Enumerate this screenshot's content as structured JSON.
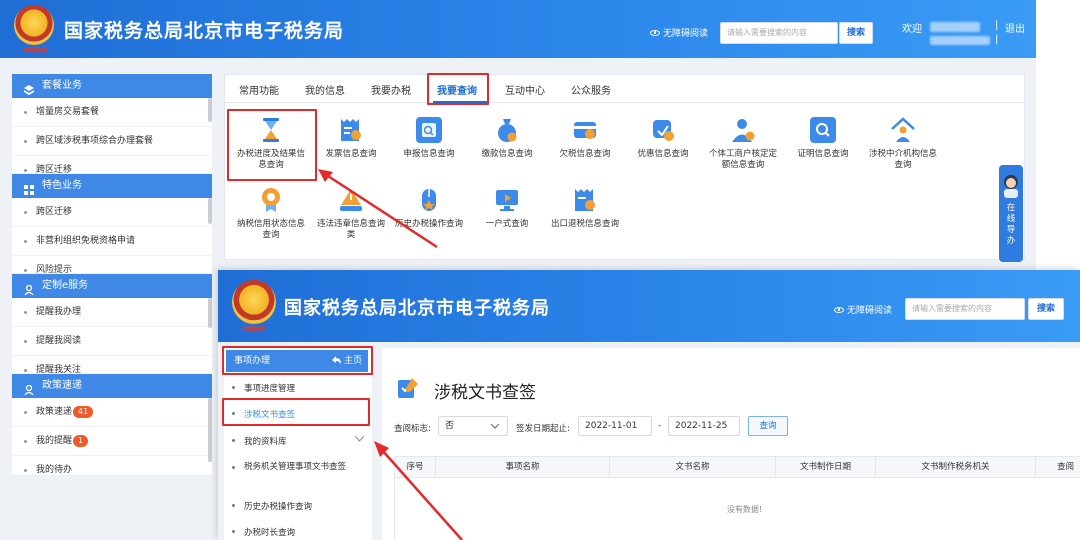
{
  "site_title": "国家税务总局北京市电子税务局",
  "emblem_caption": "中国税务",
  "header": {
    "accessibility_label": "无障碍阅读",
    "search_placeholder": "请输入需要搜索的内容",
    "search_button": "搜索",
    "welcome": "欢迎",
    "divider": "|",
    "logout": "退出"
  },
  "sidebar": {
    "sections": [
      {
        "title": "套餐业务",
        "icon": "package-icon",
        "items": [
          "增量房交易套餐",
          "跨区域涉税事项综合办理套餐",
          "跨区迁移"
        ]
      },
      {
        "title": "特色业务",
        "icon": "grid-icon",
        "items": [
          "跨区迁移",
          "非营利组织免税资格申请",
          "风险提示"
        ]
      },
      {
        "title": "定制e服务",
        "icon": "user-icon",
        "items": [
          "提醒我办理",
          "提醒我阅读",
          "提醒我关注"
        ]
      },
      {
        "title": "政策速递",
        "icon": "user-icon",
        "items": [
          "政策速递",
          "我的提醒",
          "我的待办"
        ]
      }
    ],
    "badges": {
      "policy": "41",
      "reminder": "1"
    }
  },
  "tabs": [
    "常用功能",
    "我的信息",
    "我要办税",
    "我要查询",
    "互动中心",
    "公众服务"
  ],
  "active_tab": "我要查询",
  "functions": [
    {
      "label": "办税进度及结果信息查询",
      "icon": "hourglass-icon",
      "color": "#2f7be0"
    },
    {
      "label": "发票信息查询",
      "icon": "invoice-icon",
      "color": "#3c8bea"
    },
    {
      "label": "申报信息查询",
      "icon": "report-icon",
      "color": "#3c8bea"
    },
    {
      "label": "缴款信息查询",
      "icon": "money-bag-icon",
      "color": "#3c8bea"
    },
    {
      "label": "欠税信息查询",
      "icon": "card-icon",
      "color": "#3c8bea"
    },
    {
      "label": "优惠信息查询",
      "icon": "discount-tag-icon",
      "color": "#3c8bea"
    },
    {
      "label": "个体工商户核定定额信息查询",
      "icon": "person-icon",
      "color": "#3c8bea"
    },
    {
      "label": "证明信息查询",
      "icon": "certificate-icon",
      "color": "#3c8bea"
    },
    {
      "label": "涉税中介机构信息查询",
      "icon": "agency-icon",
      "color": "#3c8bea"
    },
    {
      "label": "纳税信用状态信息查询",
      "icon": "medal-icon",
      "color": "#f2a033"
    },
    {
      "label": "违法违章信息查询类",
      "icon": "warning-hand-icon",
      "color": "#3c8bea"
    },
    {
      "label": "历史办税操作查询",
      "icon": "mouse-icon",
      "color": "#3c8bea"
    },
    {
      "label": "一户式查询",
      "icon": "monitor-icon",
      "color": "#3c8bea"
    },
    {
      "label": "出口退税信息查询",
      "icon": "export-doc-icon",
      "color": "#3c8bea"
    }
  ],
  "float_guide": "在线导办",
  "front": {
    "menu_head": "事项办理",
    "home_link": "主页",
    "menu_items": [
      "事项进度管理",
      "涉税文书查签",
      "我的资料库",
      "税务机关管理事项文书查签",
      "历史办税操作查询",
      "办税时长查询"
    ],
    "active_menu": "涉税文书查签",
    "page_title": "涉税文书查签",
    "filter": {
      "read_flag_label": "查阅标志:",
      "read_flag_value": "否",
      "date_label": "签发日期起止:",
      "date_start": "2022-11-01",
      "date_sep": "-",
      "date_end": "2022-11-25",
      "query_button": "查询"
    },
    "table_headers": [
      "序号",
      "事项名称",
      "文书名称",
      "文书制作日期",
      "文书制作税务机关",
      "查阅"
    ],
    "empty_text": "没有数据!"
  },
  "colors": {
    "brand_blue": "#1f6ed6",
    "highlight_red": "#e4292a",
    "badge_orange": "#f05a28"
  }
}
